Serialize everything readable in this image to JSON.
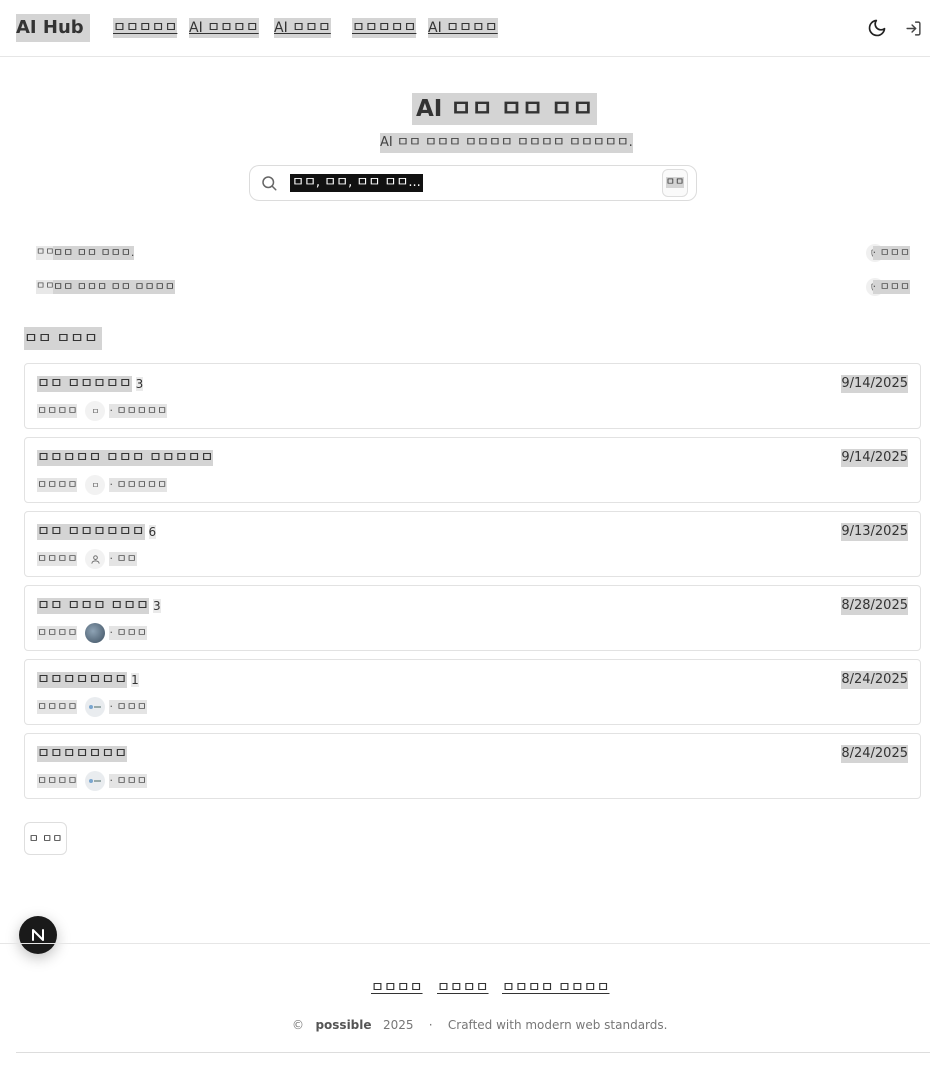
{
  "header": {
    "logo": "AI Hub",
    "nav": [
      "ㅁㅁㅁㅁㅁ",
      "AI ㅁㅁㅁㅁ",
      "AI ㅁㅁㅁ",
      "ㅁㅁㅁㅁㅁ",
      "AI ㅁㅁㅁㅁ"
    ],
    "theme_icon": "moon-icon",
    "login_icon": "login-icon"
  },
  "hero": {
    "title": "AI ㅁㅁ ㅁㅁ ㅁㅁ",
    "subtitle": "AI ㅁㅁ ㅁㅁㅁ ㅁㅁㅁㅁ ㅁㅁㅁㅁ ㅁㅁㅁㅁㅁ.",
    "search_placeholder": "ㅁㅁ, ㅁㅁ, ㅁㅁ ㅁㅁ...",
    "search_shortcut": "ㅁㅁ"
  },
  "notices": [
    {
      "tag": "ㅁㅁ",
      "text": "ㅁㅁ ㅁㅁ ㅁㅁㅁ.",
      "author": "· ㅁㅁㅁ"
    },
    {
      "tag": "ㅁㅁ",
      "text": "ㅁㅁ ㅁㅁㅁ ㅁㅁ ㅁㅁㅁㅁ",
      "author": "· ㅁㅁㅁ"
    }
  ],
  "section_title": "ㅁㅁ ㅁㅁㅁ",
  "posts": [
    {
      "title": "ㅁㅁ ㅁㅁㅁㅁㅁ",
      "count": "3",
      "date": "9/14/2025",
      "category": "ㅁㅁㅁㅁ",
      "avatar": "ㅁ",
      "author": "· ㅁㅁㅁㅁㅁ"
    },
    {
      "title": "ㅁㅁㅁㅁㅁ ㅁㅁㅁ ㅁㅁㅁㅁㅁ",
      "count": "",
      "date": "9/14/2025",
      "category": "ㅁㅁㅁㅁ",
      "avatar": "ㅁ",
      "author": "· ㅁㅁㅁㅁㅁ"
    },
    {
      "title": "ㅁㅁ ㅁㅁㅁㅁㅁㅁ",
      "count": "6",
      "date": "9/13/2025",
      "category": "ㅁㅁㅁㅁ",
      "avatar": "user",
      "author": "· ㅁㅁ"
    },
    {
      "title": "ㅁㅁ ㅁㅁㅁ ㅁㅁㅁ",
      "count": "3",
      "date": "8/28/2025",
      "category": "ㅁㅁㅁㅁ",
      "avatar": "photo",
      "author": "· ㅁㅁㅁ"
    },
    {
      "title": "ㅁㅁㅁㅁㅁㅁㅁ",
      "count": "1",
      "date": "8/24/2025",
      "category": "ㅁㅁㅁㅁ",
      "avatar": "logo",
      "author": "· ㅁㅁㅁ"
    },
    {
      "title": "ㅁㅁㅁㅁㅁㅁㅁ",
      "count": "",
      "date": "8/24/2025",
      "category": "ㅁㅁㅁㅁ",
      "avatar": "logo",
      "author": "· ㅁㅁㅁ"
    }
  ],
  "write_button": "ㅁ ㅁㅁ",
  "fab_letter": "N",
  "footer": {
    "links": [
      "ㅁㅁㅁㅁ",
      "ㅁㅁㅁㅁ",
      "ㅁㅁㅁㅁ ㅁㅁㅁㅁ"
    ],
    "copyright_symbol": "©",
    "brand": "possible",
    "year": "2025",
    "separator": "·",
    "tagline": "Crafted with modern web standards."
  }
}
